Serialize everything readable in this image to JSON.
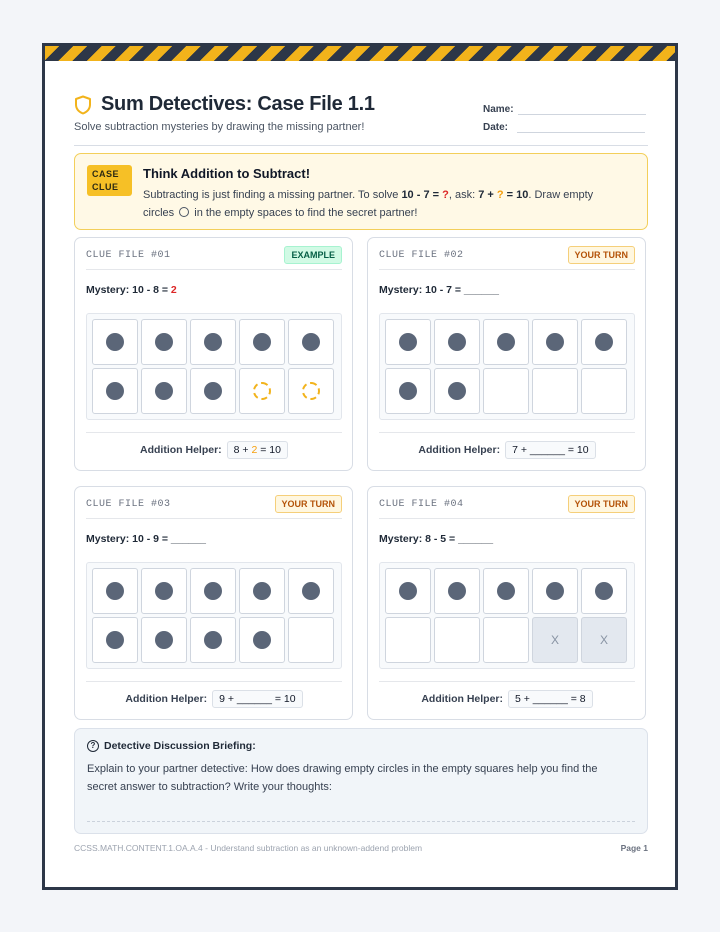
{
  "header": {
    "title": "Sum Detectives: Case File 1.1",
    "subtitle": "Solve subtraction mysteries by drawing the missing partner!",
    "name_label": "Name:",
    "date_label": "Date:"
  },
  "clue": {
    "badge_line1": "CASE",
    "badge_line2": "CLUE",
    "title": "Think Addition to Subtract!",
    "text_a": "Subtracting is just finding a missing partner. To solve ",
    "eq1": "10 - 7 = ",
    "eq1_q": "?",
    "text_b": ", ask: ",
    "eq2a": "7 + ",
    "eq2_q": "?",
    "eq2b": " = 10",
    "text_c": ". Draw empty circles ",
    "text_d": " in the empty spaces to find the secret partner!"
  },
  "cards": [
    {
      "label": "CLUE FILE #01",
      "tag": "EXAMPLE",
      "mystery": "Mystery: 10 - 8 = ",
      "answer": "2",
      "cells": [
        "dot",
        "dot",
        "dot",
        "dot",
        "dot",
        "dot",
        "dot",
        "dot",
        "dash",
        "dash"
      ],
      "helper_label": "Addition Helper:",
      "helper_a": "8 + ",
      "helper_mid": "2",
      "helper_b": " = 10"
    },
    {
      "label": "CLUE FILE #02",
      "tag": "YOUR TURN",
      "mystery": "Mystery: 10 - 7 = ______",
      "answer": "",
      "cells": [
        "dot",
        "dot",
        "dot",
        "dot",
        "dot",
        "dot",
        "dot",
        "empty",
        "empty",
        "empty"
      ],
      "helper_label": "Addition Helper:",
      "helper_a": "7 + ______ = 10",
      "helper_mid": "",
      "helper_b": ""
    },
    {
      "label": "CLUE FILE #03",
      "tag": "YOUR TURN",
      "mystery": "Mystery: 10 - 9 = ______",
      "answer": "",
      "cells": [
        "dot",
        "dot",
        "dot",
        "dot",
        "dot",
        "dot",
        "dot",
        "dot",
        "dot",
        "empty"
      ],
      "helper_label": "Addition Helper:",
      "helper_a": "9 + ______ = 10",
      "helper_mid": "",
      "helper_b": ""
    },
    {
      "label": "CLUE FILE #04",
      "tag": "YOUR TURN",
      "mystery": "Mystery: 8 - 5 = ______",
      "answer": "",
      "cells": [
        "dot",
        "dot",
        "dot",
        "dot",
        "dot",
        "empty",
        "empty",
        "empty",
        "x",
        "x"
      ],
      "helper_label": "Addition Helper:",
      "helper_a": "5 + ______ = 8",
      "helper_mid": "",
      "helper_b": ""
    }
  ],
  "x_mark": "X",
  "discussion": {
    "title": "Detective Discussion Briefing:",
    "text": "Explain to your partner detective: How does drawing empty circles in the empty squares help you find the secret answer to subtraction? Write your thoughts:"
  },
  "footer": {
    "standard": "CCSS.MATH.CONTENT.1.OA.A.4 - Understand subtraction as an unknown-addend problem",
    "page": "Page 1"
  },
  "colors": {
    "accent": "#f2b31b",
    "dark": "#2d3748",
    "answer_red": "#dc2626"
  }
}
